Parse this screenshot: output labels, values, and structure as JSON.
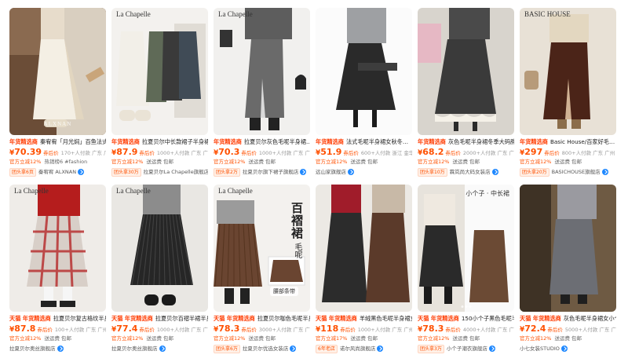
{
  "products": [
    {
      "brand": "",
      "watermark": "ALXNAN",
      "tag": "年货精选商",
      "title": "秦宥宥「月光焖」百鱼法式…",
      "price": "70.39",
      "price_tag": "券后价",
      "meta": "170+人付款  广东 广州",
      "sub_dist": "官方立减12%",
      "sub": "热销榜6  #fashion",
      "badge": "团头拿6页",
      "shop": "秦宥宥 ALXNAN"
    },
    {
      "brand": "La Chapelle",
      "watermark": "",
      "tag": "年货精选商",
      "title": "拉夏贝尔中长款裙子半身裙女2026新…",
      "price": "87.9",
      "price_tag": "券后价",
      "meta": "1000+人付款  广东 广州",
      "sub_dist": "官方立减12%",
      "sub": "送运费  包邮",
      "badge": "团头拿30万",
      "shop": "拉夏贝尔La Chapelle旗舰店"
    },
    {
      "brand": "La Chapelle",
      "watermark": "",
      "tag": "年货精选商",
      "title": "拉夏贝尔灰色毛呢半身裙…",
      "price": "70.3",
      "price_tag": "券后价",
      "meta": "1000+人付款  广东 广州",
      "sub_dist": "官方立减12%",
      "sub": "送运费  包邮",
      "badge": "团头拿2万",
      "shop": "拉夏贝尔旗下裙子旗舰店"
    },
    {
      "brand": "",
      "watermark": "",
      "tag": "年货精选商",
      "title": "法式毛呢半身裙女秋冬…",
      "price": "51.9",
      "price_tag": "券后价",
      "meta": "600+人付款  浙江 金华",
      "sub_dist": "官方立减12%",
      "sub": "送运费  包邮",
      "badge": "",
      "shop": "远山家旗舰店"
    },
    {
      "brand": "",
      "watermark": "",
      "tag": "年货精选商",
      "title": "灰色毛呢半身裙冬季大码胖mm…",
      "price": "68.2",
      "price_tag": "券后价",
      "meta": "2000+人付款  广东 广州",
      "sub_dist": "官方立减12%",
      "sub": "送运费  包邮",
      "badge": "团头拿10万",
      "shop": "霖岚尚大码女装店"
    },
    {
      "brand": "BASIC HOUSE",
      "watermark": "",
      "tag": "年货精选商",
      "title": "Basic House/百家好毛…",
      "price": "297",
      "price_tag": "券后价",
      "meta": "800+人付款  广东 广州",
      "sub_dist": "官方立减12%",
      "sub": "送运费  包邮",
      "badge": "团头拿20万",
      "shop": "BASICHOUSE旗舰店"
    },
    {
      "brand": "La Chapelle",
      "watermark": "",
      "tag": "天猫 年货精选商",
      "title": "拉夏贝尔复古格纹半身…",
      "price": "87.8",
      "price_tag": "券后价",
      "meta": "100+人付款  广东 广州",
      "sub_dist": "官方立减12%",
      "sub": "送运费  包邮",
      "badge": "",
      "shop": "拉夏贝尔奥丝旗舰店"
    },
    {
      "brand": "La Chapelle",
      "watermark": "",
      "tag": "天猫 年货精选商",
      "title": "拉夏贝尔百褶半裙半身…",
      "price": "77.4",
      "price_tag": "券后价",
      "meta": "1000+人付款  广东 广州",
      "sub_dist": "官方立减12%",
      "sub": "送运费  包邮",
      "badge": "",
      "shop": "拉夏贝尔奥丝旗舰店"
    },
    {
      "brand": "La Chapelle",
      "watermark": "",
      "tag": "天猫 年货精选商",
      "title": "拉夏贝尔咖色毛呢半身裙…",
      "price": "78.3",
      "price_tag": "券后价",
      "meta": "3000+人付款  广东 广州",
      "sub_dist": "官方立减12%",
      "sub": "送运费  包邮",
      "badge": "团头拿6万",
      "shop": "拉夏贝尔优选女装店",
      "big_text": "百褶裙",
      "small_text": "毛呢",
      "overlay": "腰部条带"
    },
    {
      "brand": "",
      "watermark": "",
      "tag": "天猫 年货精选商",
      "title": "羊绒黑色毛呢半身裙女…",
      "price": "118",
      "price_tag": "券后价",
      "meta": "1000+人付款  广东 广州",
      "sub_dist": "官方立减17%",
      "sub": "送运费  包邮",
      "badge": "6年老店",
      "shop": "诺尔风尚旗舰店"
    },
    {
      "brand": "",
      "watermark": "",
      "tag": "天猫 年货精选商",
      "title": "150小个子黑色毛呢半身…",
      "price": "78.3",
      "price_tag": "券后价",
      "meta": "4000+人付款  广东 广州",
      "sub_dist": "官方立减12%",
      "sub": "送运费  包邮",
      "badge": "团头拿3万",
      "shop": "小个子潮衣旗舰店",
      "corner_text": "小个子 · 中长裙"
    },
    {
      "brand": "",
      "watermark": "",
      "tag": "天猫 年货精选商",
      "title": "灰色毛呢半身裙女小个子…",
      "price": "72.4",
      "price_tag": "券后价",
      "meta": "5000+人付款  广东 广州",
      "sub_dist": "官方立减12%",
      "sub": "送运费  包邮",
      "badge": "",
      "shop": "小七女装STUDIO"
    }
  ],
  "colors": {
    "accent": "#ff5000",
    "tmall_red": "#ff0036",
    "link_blue": "#1e88ff"
  }
}
